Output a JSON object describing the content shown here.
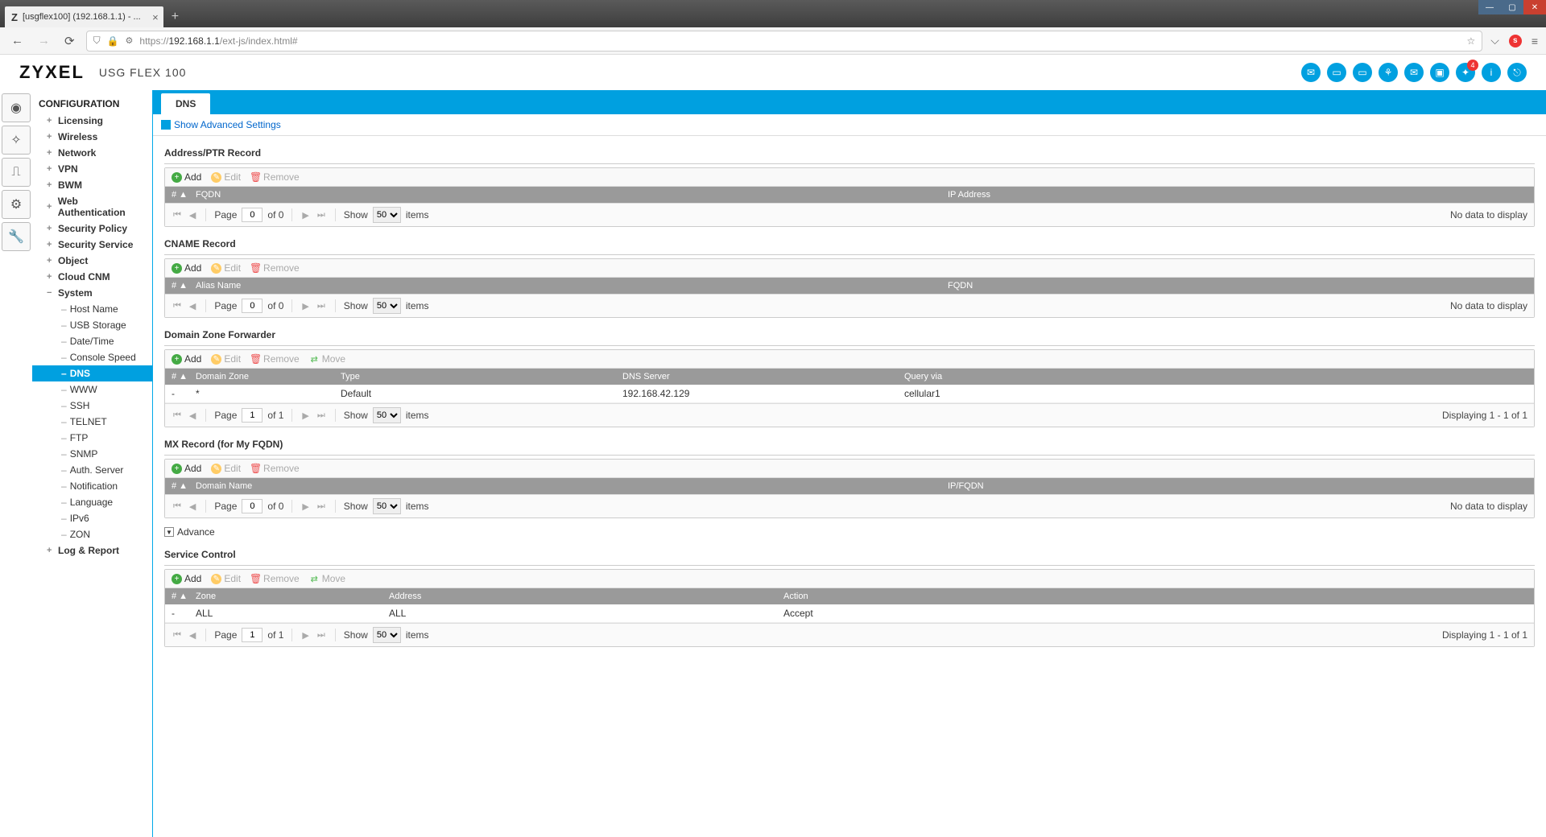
{
  "browser": {
    "tab_title": "[usgflex100] (192.168.1.1) - ...",
    "url_prefix": "https://",
    "url_host": "192.168.1.1",
    "url_path": "/ext-js/index.html#"
  },
  "brand": {
    "logo": "ZYXEL",
    "model": "USG FLEX 100",
    "notif_badge": "4"
  },
  "nav": {
    "heading": "CONFIGURATION",
    "top": [
      "Licensing",
      "Wireless",
      "Network",
      "VPN",
      "BWM",
      "Web Authentication",
      "Security Policy",
      "Security Service",
      "Object",
      "Cloud CNM"
    ],
    "system_label": "System",
    "system_children": [
      "Host Name",
      "USB Storage",
      "Date/Time",
      "Console Speed",
      "DNS",
      "WWW",
      "SSH",
      "TELNET",
      "FTP",
      "SNMP",
      "Auth. Server",
      "Notification",
      "Language",
      "IPv6",
      "ZON"
    ],
    "system_active": "DNS",
    "log_label": "Log & Report"
  },
  "page": {
    "tab": "DNS",
    "show_advanced": "Show Advanced Settings",
    "advance_label": "Advance"
  },
  "toolbar": {
    "add": "Add",
    "edit": "Edit",
    "remove": "Remove",
    "move": "Move"
  },
  "pager": {
    "page": "Page",
    "of": "of",
    "show": "Show",
    "items": "items",
    "options": [
      "50"
    ]
  },
  "sections": {
    "address": {
      "title": "Address/PTR Record",
      "cols": [
        "#",
        "FQDN",
        "IP Address"
      ],
      "page_val": "0",
      "of_val": "0",
      "show_val": "50",
      "status": "No data to display"
    },
    "cname": {
      "title": "CNAME Record",
      "cols": [
        "#",
        "Alias Name",
        "FQDN"
      ],
      "page_val": "0",
      "of_val": "0",
      "show_val": "50",
      "status": "No data to display"
    },
    "dzf": {
      "title": "Domain Zone Forwarder",
      "cols": [
        "#",
        "Domain Zone",
        "Type",
        "DNS Server",
        "Query via"
      ],
      "rows": [
        {
          "idx": "-",
          "zone": "*",
          "type": "Default",
          "server": "192.168.42.129",
          "query": "cellular1"
        }
      ],
      "page_val": "1",
      "of_val": "1",
      "show_val": "50",
      "status": "Displaying 1 - 1 of 1"
    },
    "mx": {
      "title": "MX Record (for My FQDN)",
      "cols": [
        "#",
        "Domain Name",
        "IP/FQDN"
      ],
      "page_val": "0",
      "of_val": "0",
      "show_val": "50",
      "status": "No data to display"
    },
    "svc": {
      "title": "Service Control",
      "cols": [
        "#",
        "Zone",
        "Address",
        "Action"
      ],
      "rows": [
        {
          "idx": "-",
          "zone": "ALL",
          "addr": "ALL",
          "action": "Accept"
        }
      ],
      "page_val": "1",
      "of_val": "1",
      "show_val": "50",
      "status": "Displaying 1 - 1 of 1"
    }
  }
}
